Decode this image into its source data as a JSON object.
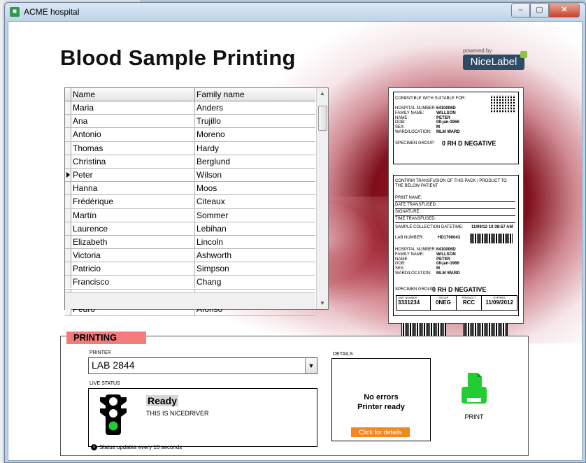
{
  "window": {
    "title": "ACME hospital",
    "app_icon": "app-logo-icon",
    "min": "–",
    "max": "▢",
    "close": "✕"
  },
  "page": {
    "title": "Blood Sample Printing"
  },
  "brand": {
    "powered_by": "powered by",
    "name": "NiceLabel"
  },
  "grid": {
    "columns": [
      "Name",
      "Family name"
    ],
    "rows": [
      [
        "Maria",
        "Anders"
      ],
      [
        "Ana",
        "Trujillo"
      ],
      [
        "Antonio",
        "Moreno"
      ],
      [
        "Thomas",
        "Hardy"
      ],
      [
        "Christina",
        "Berglund"
      ],
      [
        "Peter",
        "Wilson"
      ],
      [
        "Hanna",
        "Moos"
      ],
      [
        "Frédérique",
        "Citeaux"
      ],
      [
        "Martín",
        "Sommer"
      ],
      [
        "Laurence",
        "Lebihan"
      ],
      [
        "Elizabeth",
        "Lincoln"
      ],
      [
        "Victoria",
        "Ashworth"
      ],
      [
        "Patricio",
        "Simpson"
      ],
      [
        "Francisco",
        "Chang"
      ],
      [
        "Yang",
        "Wang"
      ],
      [
        "Pedro",
        "Afonso"
      ]
    ],
    "current_row": 5
  },
  "label_preview": {
    "compat": "COMPATIBLE WITH SUITABLE FOR:",
    "top_fields": [
      "HOSPITAL NUMBER:",
      "FAMILY NAME:",
      "NAME:",
      "DOB:",
      "SEX:",
      "WARD/LOCATION:"
    ],
    "top_values": [
      "6410006D",
      "WILLSON",
      "PETER",
      "08-jan-1966",
      "M",
      "MLM WARD"
    ],
    "specimen_group_label": "SPECIMEN GROUP:",
    "specimen_group": "0 RH D NEGATIVE",
    "confirm": "CONFIRM TRANSFUSION OF THIS PACK / PRODUCT TO THE BELOW PATIENT",
    "sign_lines": [
      "PRINT NAME:",
      "DATE TRANSFUSED:",
      "SIGNATURE:",
      "TIME TRANSFUSED:"
    ],
    "sample_collection_label": "SAMPLE COLLECTION DATETIME:",
    "sample_collection_value": "11/09/12 10:38:57 AM",
    "lab_number_label": "LAB NUMBER:",
    "lab_number": "HD1700043",
    "unit_number_label": "UNIT NUMBER",
    "unit_number": "3331234",
    "group_label": "GROUP",
    "group": "0NEG",
    "product_label": "PRODUCT",
    "product": "RCC",
    "expires_label": "EXPIRES",
    "expires": "11/09/2012"
  },
  "printing": {
    "section": "PRINTING",
    "printer_label": "PRINTER",
    "printer_value": "LAB 2844",
    "live_status_label": "LIVE STATUS",
    "status": "Ready",
    "driver": "THIS IS NICEDRIVER",
    "details_label": "DETAILS",
    "details_line1": "No errors",
    "details_line2": "Printer ready",
    "details_button": "Click for details",
    "print_button": "PRINT",
    "info_note": "Status updates every 10 seconds",
    "info_icon": "info-icon"
  },
  "colors": {
    "printing_tag": "#f47b7b",
    "details_button": "#f08a1e",
    "printer_icon": "#22cc33",
    "traffic_green": "#22cc33"
  }
}
